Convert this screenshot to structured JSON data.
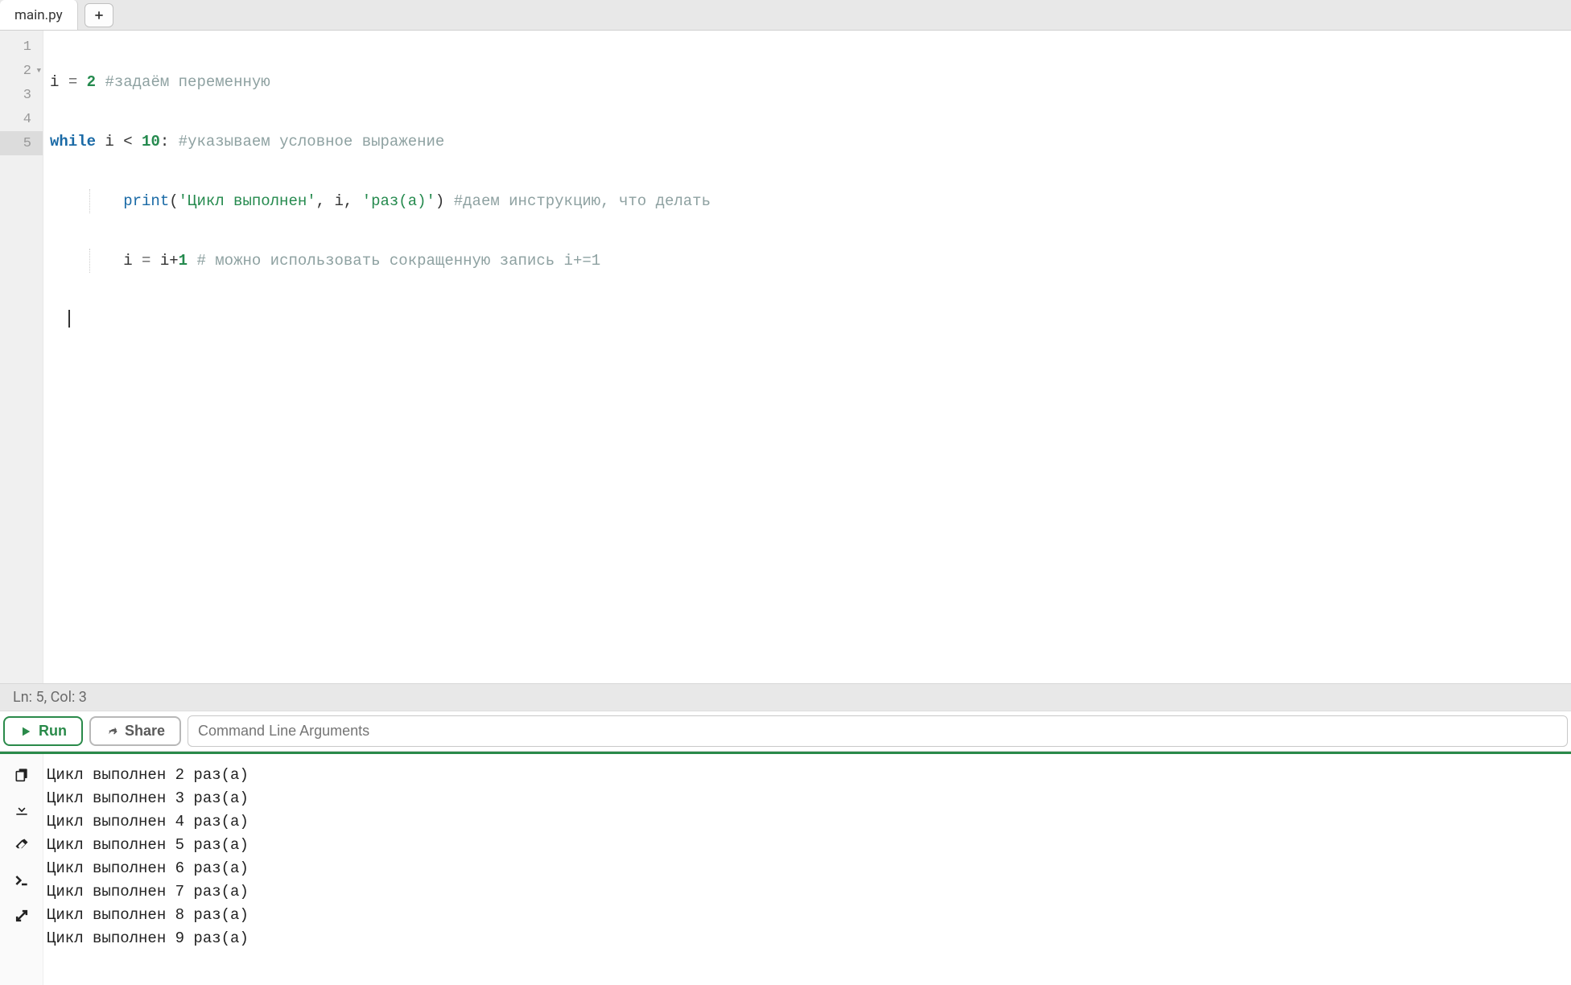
{
  "tabs": {
    "active": "main.py"
  },
  "editor": {
    "lines": [
      {
        "num": 1
      },
      {
        "num": 2,
        "fold": true
      },
      {
        "num": 3
      },
      {
        "num": 4
      },
      {
        "num": 5,
        "highlighted": true
      }
    ],
    "code": {
      "l1_lhs": "i",
      "l1_eq": "=",
      "l1_val": "2",
      "l1_comment": "#задаём переменную",
      "l2_kw": "while",
      "l2_cond_var": "i",
      "l2_cond_op": "<",
      "l2_cond_val": "10",
      "l2_colon": ":",
      "l2_comment": "#указываем условное выражение",
      "l3_builtin": "print",
      "l3_open": "(",
      "l3_str1": "'Цикл выполнен'",
      "l3_comma1": ",",
      "l3_arg2": "i",
      "l3_comma2": ",",
      "l3_str2": "'раз(а)'",
      "l3_close": ")",
      "l3_comment": "#даем инструкцию, что делать",
      "l4_lhs": "i",
      "l4_eq": "=",
      "l4_rhs_a": "i",
      "l4_rhs_op": "+",
      "l4_rhs_b": "1",
      "l4_comment": "# можно использовать сокращенную запись i+=1"
    }
  },
  "status": {
    "text": "Ln: 5,  Col: 3"
  },
  "toolbar": {
    "run_label": "Run",
    "share_label": "Share",
    "cmdline_placeholder": "Command Line Arguments"
  },
  "output": {
    "lines": [
      "Цикл выполнен 2 раз(а)",
      "Цикл выполнен 3 раз(а)",
      "Цикл выполнен 4 раз(а)",
      "Цикл выполнен 5 раз(а)",
      "Цикл выполнен 6 раз(а)",
      "Цикл выполнен 7 раз(а)",
      "Цикл выполнен 8 раз(а)",
      "Цикл выполнен 9 раз(а)"
    ]
  }
}
